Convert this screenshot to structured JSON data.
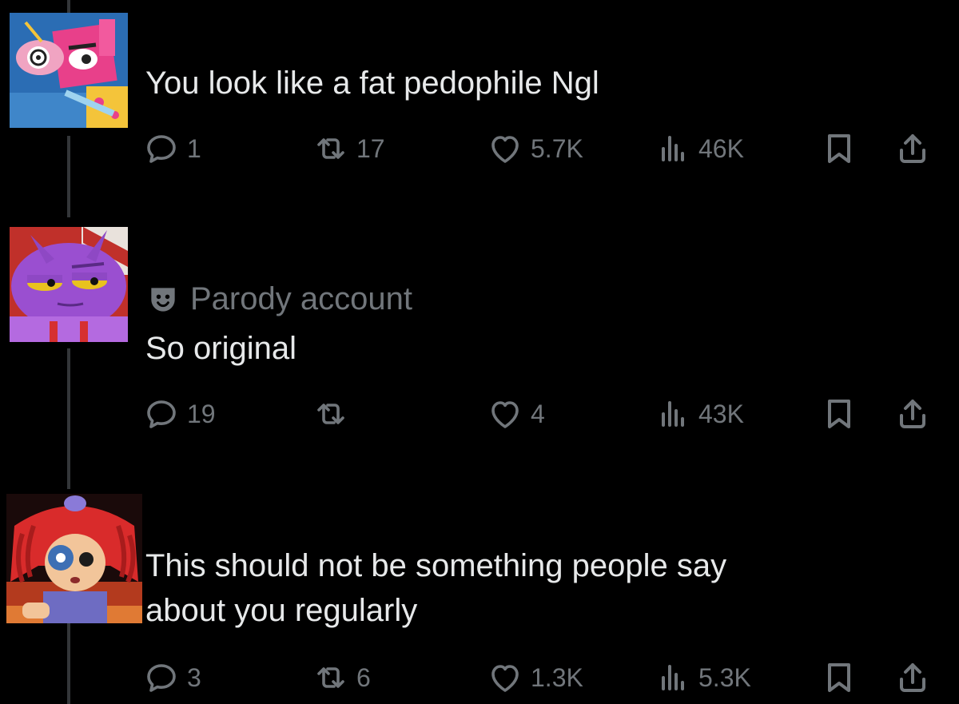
{
  "posts": [
    {
      "badge": "",
      "text": "You look like a fat pedophile Ngl",
      "reply_count": "1",
      "repost_count": "17",
      "like_count": "5.7K",
      "view_count": "46K"
    },
    {
      "badge": "Parody account",
      "text": "So original",
      "reply_count": "19",
      "repost_count": "",
      "like_count": "4",
      "view_count": "43K"
    },
    {
      "badge": "",
      "text_line1": "This should not be something people say",
      "text_line2": "about you regularly",
      "reply_count": "3",
      "repost_count": "6",
      "like_count": "1.3K",
      "view_count": "5.3K"
    }
  ],
  "icons": {
    "reply": "reply-icon",
    "repost": "repost-icon",
    "like": "heart-icon",
    "views": "views-icon",
    "bookmark": "bookmark-icon",
    "share": "share-icon",
    "parody": "theater-mask-icon"
  },
  "colors": {
    "background": "#000000",
    "text": "#e7e9ea",
    "muted": "#71767b",
    "thread_line": "#333639"
  }
}
